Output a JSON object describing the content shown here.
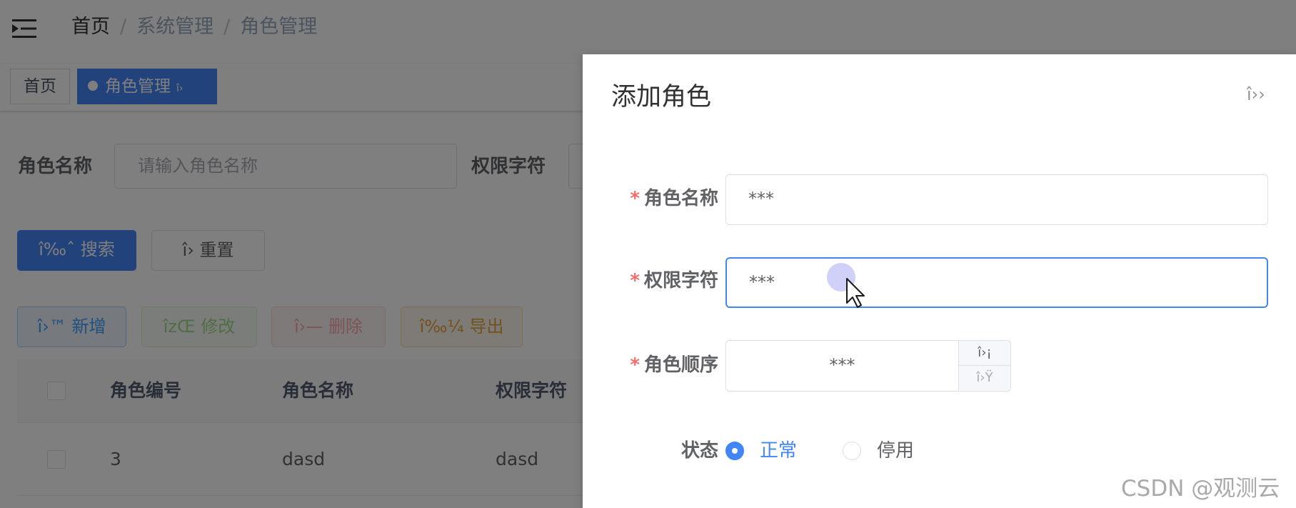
{
  "breadcrumb": {
    "home": "首页",
    "sep": "/",
    "level1": "系统管理",
    "level2": "角色管理"
  },
  "tags": {
    "home": "首页",
    "active": "角色管理",
    "active_close": "î›"
  },
  "search_form": {
    "role_name_label": "角色名称",
    "role_name_placeholder": "请输入角色名称",
    "perm_label": "权限字符",
    "search_button": "î‰ˆ 搜索",
    "reset_button": "î› 重置"
  },
  "toolbar": {
    "add": "î›™ 新增",
    "edit": "îzŒ 修改",
    "delete": "î›— 删除",
    "export": "î‰¼ 导出"
  },
  "table": {
    "headers": [
      "角色编号",
      "角色名称",
      "权限字符"
    ],
    "rows": [
      [
        "3",
        "dasd",
        "dasd"
      ]
    ]
  },
  "dialog": {
    "title": "添加角色",
    "close_glyph": "î››",
    "role_name_label": "角色名称",
    "role_name_value": "***",
    "perm_label": "权限字符",
    "perm_value": "***",
    "order_label": "角色顺序",
    "order_value": "***",
    "order_up": "î›¡",
    "order_down": "î›Ÿ",
    "status_label": "状态",
    "status_options": [
      "正常",
      "停用"
    ],
    "status_selected": "正常",
    "required_mark": "*"
  },
  "watermark": "CSDN @观测云",
  "colors": {
    "primary": "#4285f4",
    "required": "#f56c6c",
    "cursor_halo": "#c8c8f8"
  }
}
